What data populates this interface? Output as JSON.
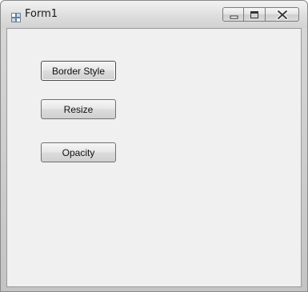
{
  "window": {
    "title": "Form1"
  },
  "caption_buttons": {
    "minimize_icon": "minimize-icon",
    "maximize_icon": "maximize-icon",
    "close_icon": "close-icon"
  },
  "buttons": {
    "border_style": "Border Style",
    "resize": "Resize",
    "opacity": "Opacity"
  }
}
